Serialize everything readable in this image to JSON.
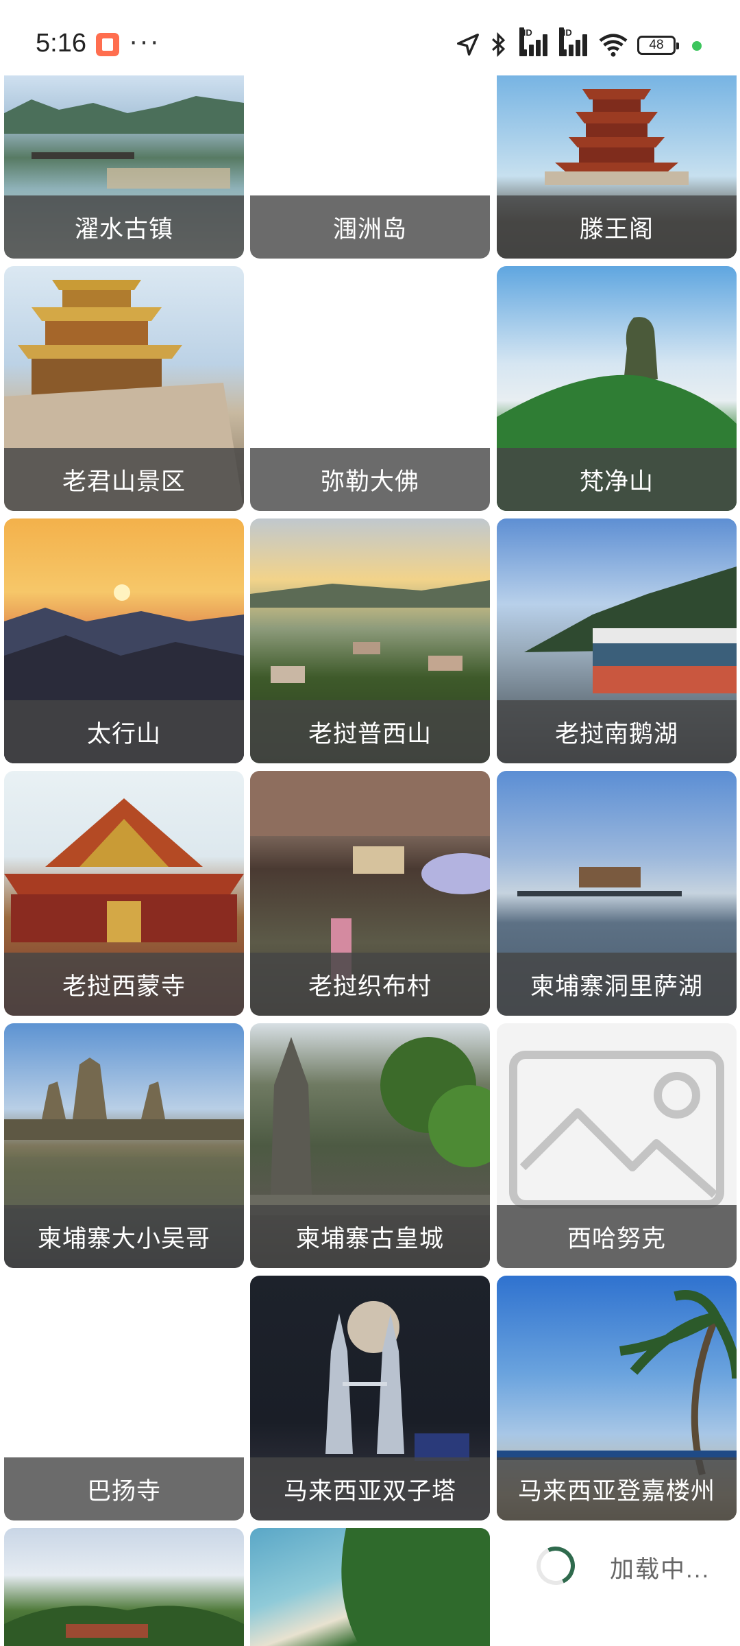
{
  "status": {
    "time": "5:16",
    "battery": "48"
  },
  "cards": [
    {
      "label": "濯水古镇"
    },
    {
      "label": "涠洲岛"
    },
    {
      "label": "滕王阁"
    },
    {
      "label": "老君山景区"
    },
    {
      "label": "弥勒大佛"
    },
    {
      "label": "梵净山"
    },
    {
      "label": "太行山"
    },
    {
      "label": "老挝普西山"
    },
    {
      "label": "老挝南鹅湖"
    },
    {
      "label": "老挝西蒙寺"
    },
    {
      "label": "老挝织布村"
    },
    {
      "label": "柬埔寨洞里萨湖"
    },
    {
      "label": "柬埔寨大小吴哥"
    },
    {
      "label": "柬埔寨古皇城"
    },
    {
      "label": "西哈努克"
    },
    {
      "label": "巴扬寺"
    },
    {
      "label": "马来西亚双子塔"
    },
    {
      "label": "马来西亚登嘉楼州"
    }
  ],
  "loading": {
    "text": "加载中..."
  }
}
